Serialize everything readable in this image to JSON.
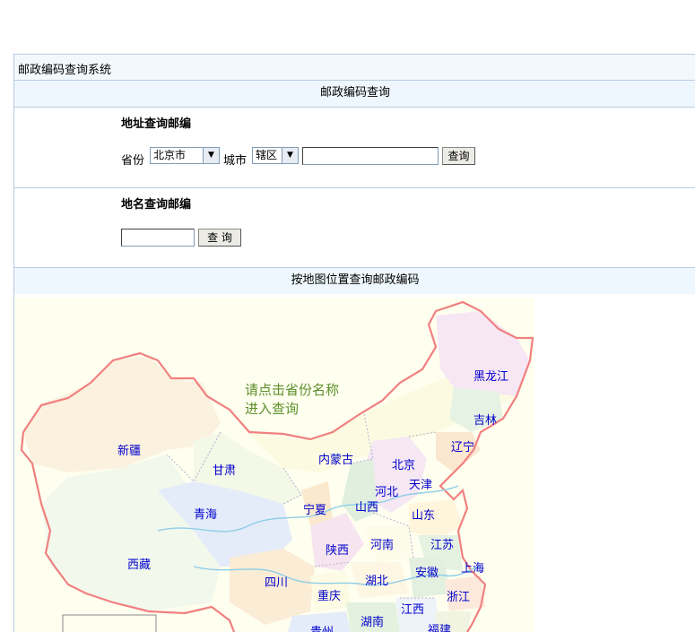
{
  "system_title": "邮政编码查询系统",
  "section_query": {
    "title": "邮政编码查询"
  },
  "address_query": {
    "title": "地址查询邮编",
    "province_label": "省份",
    "province_value": "北京市",
    "city_label": "城市",
    "city_value": "辖区",
    "search_button": "查询"
  },
  "name_query": {
    "title": "地名查询邮编",
    "search_button": "查 询"
  },
  "section_map": {
    "title": "按地图位置查询邮政编码"
  },
  "map": {
    "hint_line1": "请点击省份名称",
    "hint_line2": "进入查询",
    "provinces": {
      "heilongjiang": "黑龙江",
      "jilin": "吉林",
      "liaoning": "辽宁",
      "xinjiang": "新疆",
      "gansu": "甘肃",
      "neimenggu": "内蒙古",
      "beijing": "北京",
      "tianjin": "天津",
      "hebei": "河北",
      "shanxi": "山西",
      "shandong": "山东",
      "qinghai": "青海",
      "ningxia": "宁夏",
      "shaanxi": "陕西",
      "henan": "河南",
      "jiangsu": "江苏",
      "xizang": "西藏",
      "sichuan": "四川",
      "hubei": "湖北",
      "anhui": "安徽",
      "shanghai": "上海",
      "chongqing": "重庆",
      "zhejiang": "浙江",
      "jiangxi": "江西",
      "hunan": "湖南",
      "guizhou": "贵州",
      "fujian": "福建"
    }
  },
  "colors": {
    "border": "#b9cde5",
    "header_bg": "#eef7fd",
    "province_label": "#0000cc",
    "hint": "#5c8f2a",
    "map_outline": "#f08080"
  }
}
